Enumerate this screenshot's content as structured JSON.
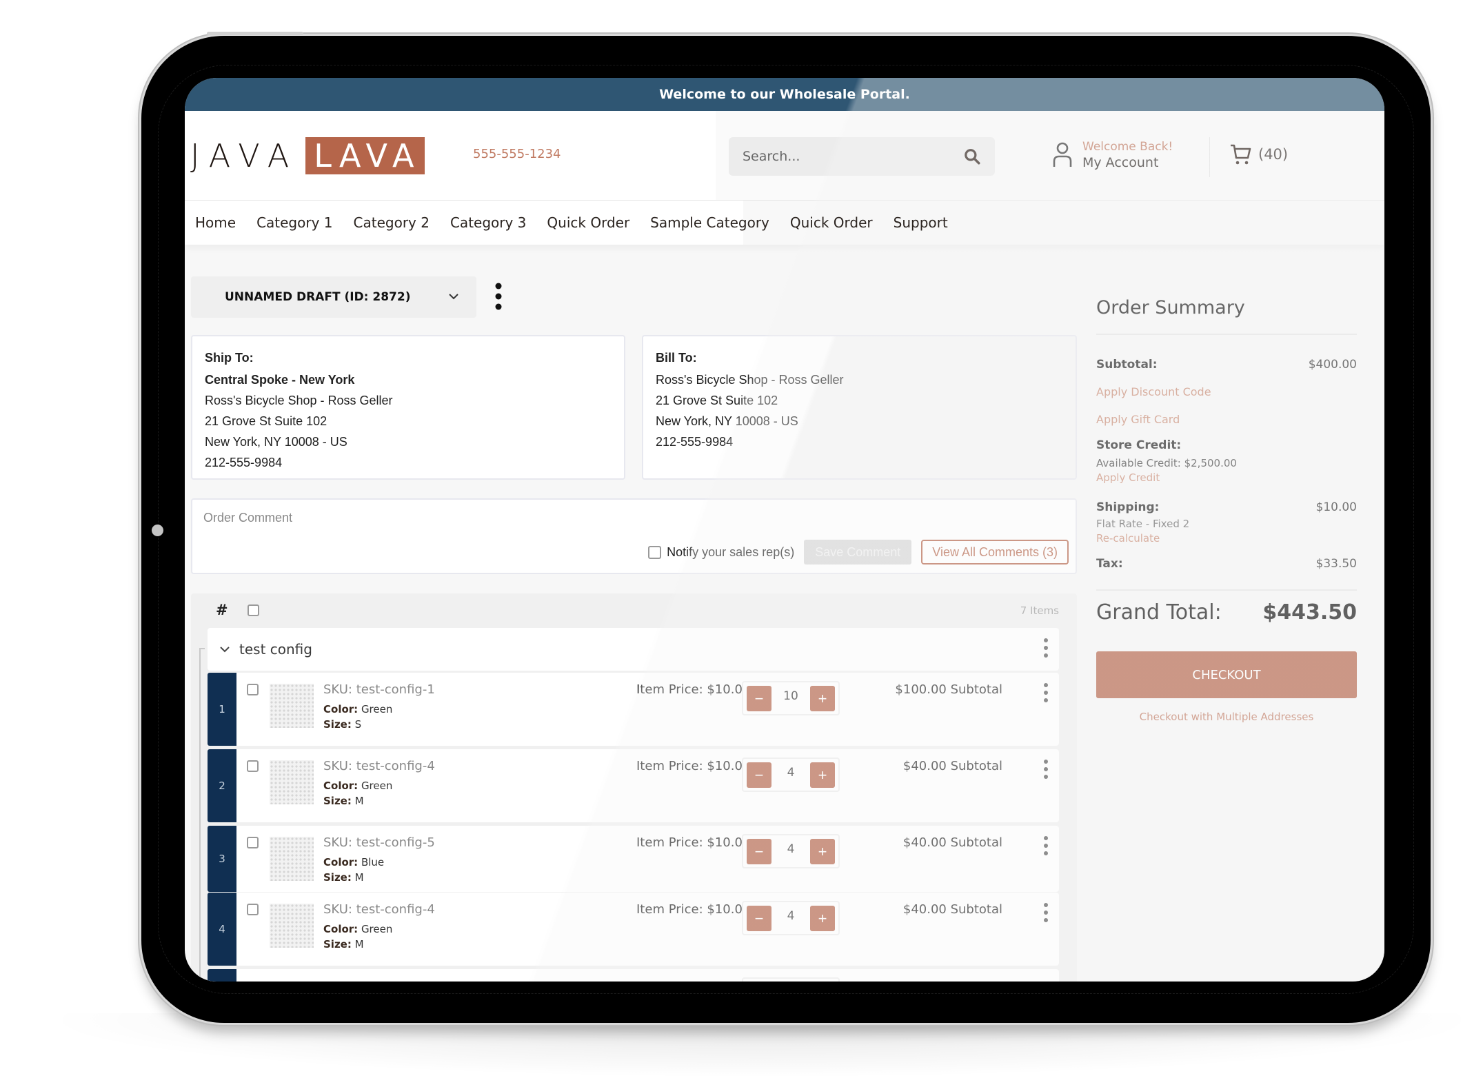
{
  "banner": {
    "text": "Welcome to our Wholesale Portal."
  },
  "header": {
    "logo_left": "JAVA",
    "logo_right": "LAVA",
    "phone": "555-555-1234",
    "search_placeholder": "Search...",
    "account_greeting": "Welcome Back!",
    "account_label": "My Account",
    "cart_count": "(40)"
  },
  "nav": {
    "items": [
      {
        "label": "Home"
      },
      {
        "label": "Category 1"
      },
      {
        "label": "Category 2"
      },
      {
        "label": "Category 3"
      },
      {
        "label": "Quick Order"
      },
      {
        "label": "Sample Category"
      },
      {
        "label": "Quick Order"
      },
      {
        "label": "Support"
      }
    ]
  },
  "draft": {
    "selected": "UNNAMED DRAFT (ID: 2872)"
  },
  "ship_to": {
    "title": "Ship To:",
    "name": "Central Spoke - New York",
    "lines": [
      "Ross's Bicycle Shop - Ross Geller",
      "21 Grove St Suite 102",
      "New York, NY 10008 - US",
      "212-555-9984"
    ]
  },
  "bill_to": {
    "title": "Bill To:",
    "lines": [
      "Ross's Bicycle Shop - Ross Geller",
      "21 Grove St Suite 102",
      "New York, NY 10008 - US",
      "212-555-9984"
    ]
  },
  "comment": {
    "placeholder": "Order Comment",
    "notify_label": "Notify your sales rep(s)",
    "save_label": "Save Comment",
    "view_label": "View All Comments (3)"
  },
  "items": {
    "hash": "#",
    "count_label": "7 Items",
    "group_name": "test config",
    "rows": [
      {
        "index": "1",
        "sku": "SKU: test-config-1",
        "color_label": "Color:",
        "color": "Green",
        "size_label": "Size:",
        "size": "S",
        "price": "Item Price: $10.00",
        "qty": "10",
        "subtotal": "$100.00 Subtotal"
      },
      {
        "index": "2",
        "sku": "SKU: test-config-4",
        "color_label": "Color:",
        "color": "Green",
        "size_label": "Size:",
        "size": "M",
        "price": "Item Price: $10.00",
        "qty": "4",
        "subtotal": "$40.00 Subtotal"
      },
      {
        "index": "3",
        "sku": "SKU: test-config-5",
        "color_label": "Color:",
        "color": "Blue",
        "size_label": "Size:",
        "size": "M",
        "price": "Item Price: $10.00",
        "qty": "4",
        "subtotal": "$40.00 Subtotal"
      },
      {
        "index": "4",
        "sku": "SKU: test-config-4",
        "color_label": "Color:",
        "color": "Green",
        "size_label": "Size:",
        "size": "M",
        "price": "Item Price: $10.00",
        "qty": "4",
        "subtotal": "$40.00 Subtotal"
      }
    ],
    "minus": "−",
    "plus": "+"
  },
  "summary": {
    "title": "Order Summary",
    "subtotal_label": "Subtotal:",
    "subtotal_value": "$400.00",
    "discount_link": "Apply Discount Code",
    "gift_link": "Apply Gift Card",
    "credit_label": "Store Credit:",
    "credit_available": "Available Credit: $2,500.00",
    "credit_link": "Apply Credit",
    "shipping_label": "Shipping:",
    "shipping_value": "$10.00",
    "shipping_method": "Flat Rate - Fixed 2",
    "recalc_link": "Re-calculate",
    "tax_label": "Tax:",
    "tax_value": "$33.50",
    "grand_label": "Grand Total:",
    "grand_value": "$443.50",
    "checkout_label": "CHECKOUT",
    "multi_label": "Checkout with Multiple Addresses"
  },
  "colors": {
    "banner": "#2f5673",
    "brand_accent": "#b5654a",
    "row_index": "#102f52",
    "link": "#c98b74"
  }
}
